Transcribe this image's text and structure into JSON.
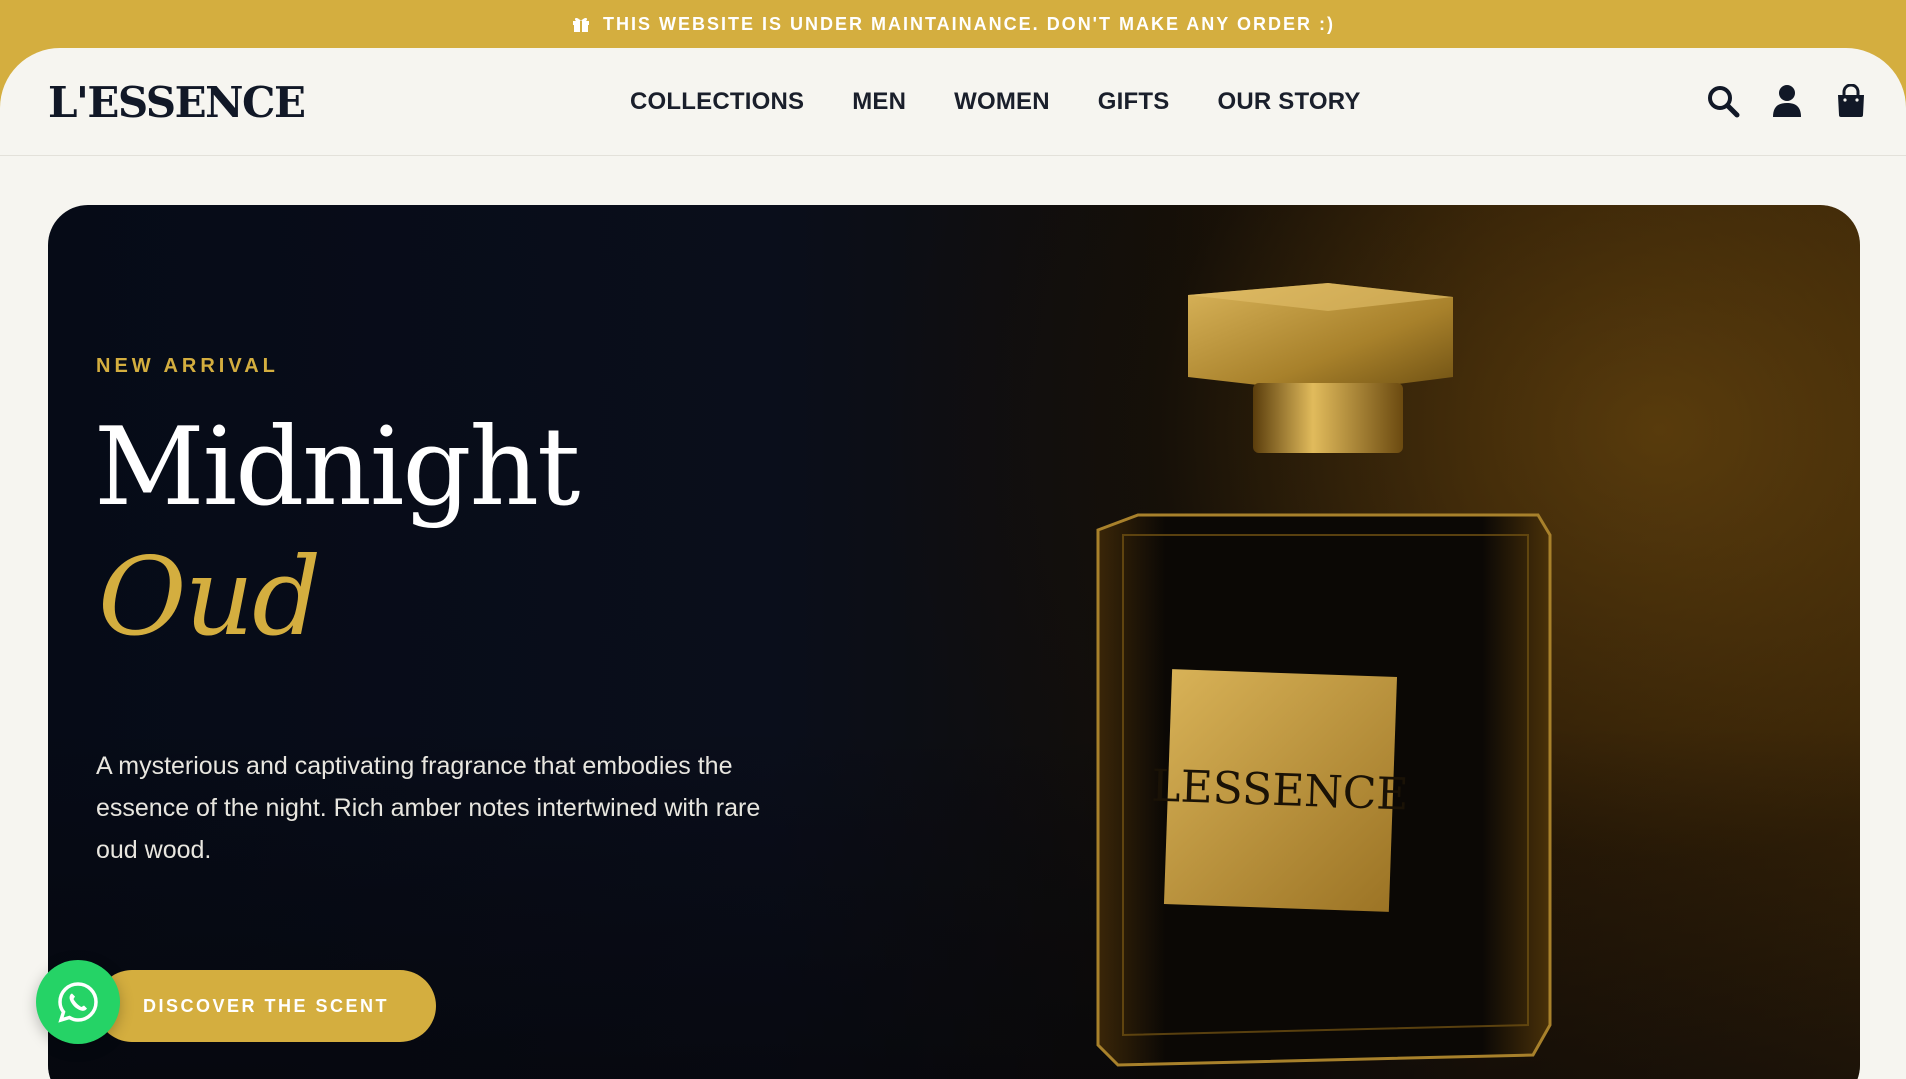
{
  "announcement": {
    "text": "THIS WEBSITE IS UNDER MAINTAINANCE. DON'T MAKE ANY ORDER :)",
    "icon": "gift-icon"
  },
  "header": {
    "logo": "L'ESSENCE",
    "nav": [
      "COLLECTIONS",
      "MEN",
      "WOMEN",
      "GIFTS",
      "OUR STORY"
    ],
    "icons": [
      "search-icon",
      "user-icon",
      "shopping-bag-icon"
    ]
  },
  "hero": {
    "kicker": "NEW ARRIVAL",
    "title_line1": "Midnight",
    "title_line2": "Oud",
    "description": "A mysterious and captivating fragrance that embodies the essence of the night. Rich amber notes intertwined with rare oud wood.",
    "cta_label": "DISCOVER THE SCENT",
    "bottle_label": "LESSENCE"
  },
  "floating": {
    "whatsapp_icon": "whatsapp-icon"
  },
  "colors": {
    "accent": "#d4ae3f",
    "dark": "#0a0e1b",
    "page_bg": "#f6f5f0",
    "whatsapp": "#25d366"
  }
}
